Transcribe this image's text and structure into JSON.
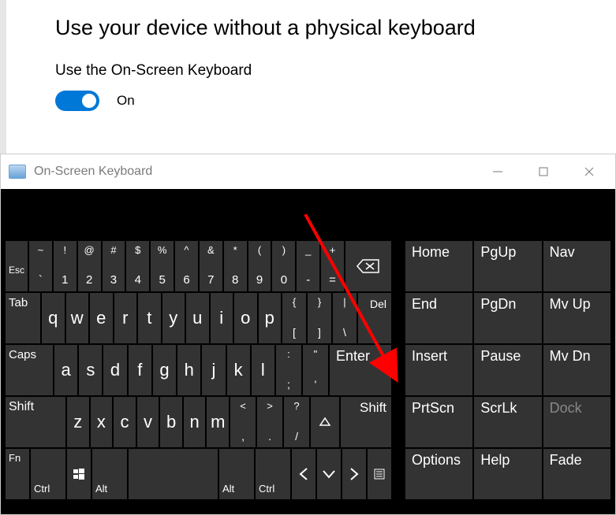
{
  "settings": {
    "heading": "Use your device without a physical keyboard",
    "subheading": "Use the On-Screen Keyboard",
    "toggle_state": "On"
  },
  "osk": {
    "title": "On-Screen Keyboard",
    "rows": {
      "num": {
        "esc": "Esc",
        "keys": [
          {
            "top": "~",
            "bot": "`"
          },
          {
            "top": "!",
            "bot": "1"
          },
          {
            "top": "@",
            "bot": "2"
          },
          {
            "top": "#",
            "bot": "3"
          },
          {
            "top": "$",
            "bot": "4"
          },
          {
            "top": "%",
            "bot": "5"
          },
          {
            "top": "^",
            "bot": "6"
          },
          {
            "top": "&",
            "bot": "7"
          },
          {
            "top": "*",
            "bot": "8"
          },
          {
            "top": "(",
            "bot": "9"
          },
          {
            "top": ")",
            "bot": "0"
          },
          {
            "top": "_",
            "bot": "-"
          },
          {
            "top": "+",
            "bot": "="
          }
        ],
        "backspace_name": "backspace"
      },
      "q": {
        "tab": "Tab",
        "letters": [
          "q",
          "w",
          "e",
          "r",
          "t",
          "y",
          "u",
          "i",
          "o",
          "p"
        ],
        "brackets": [
          {
            "top": "{",
            "bot": "["
          },
          {
            "top": "}",
            "bot": "]"
          },
          {
            "top": "|",
            "bot": "\\"
          }
        ],
        "del": "Del"
      },
      "a": {
        "caps": "Caps",
        "letters": [
          "a",
          "s",
          "d",
          "f",
          "g",
          "h",
          "j",
          "k",
          "l"
        ],
        "syms": [
          {
            "top": ":",
            "bot": ";"
          },
          {
            "top": "\"",
            "bot": "'"
          }
        ],
        "enter": "Enter"
      },
      "z": {
        "shiftL": "Shift",
        "letters": [
          "z",
          "x",
          "c",
          "v",
          "b",
          "n",
          "m"
        ],
        "syms": [
          {
            "top": "<",
            "bot": ","
          },
          {
            "top": ">",
            "bot": "."
          },
          {
            "top": "?",
            "bot": "/"
          }
        ],
        "shiftR": "Shift"
      },
      "fn": {
        "fn": "Fn",
        "ctrl": "Ctrl",
        "alt": "Alt"
      }
    },
    "side": {
      "col1": [
        "Home",
        "End",
        "Insert",
        "PrtScn",
        "Options"
      ],
      "col2": [
        "PgUp",
        "PgDn",
        "Pause",
        "ScrLk",
        "Help"
      ],
      "col3": [
        "Nav",
        "Mv Up",
        "Mv Dn",
        "Dock",
        "Fade"
      ]
    }
  }
}
